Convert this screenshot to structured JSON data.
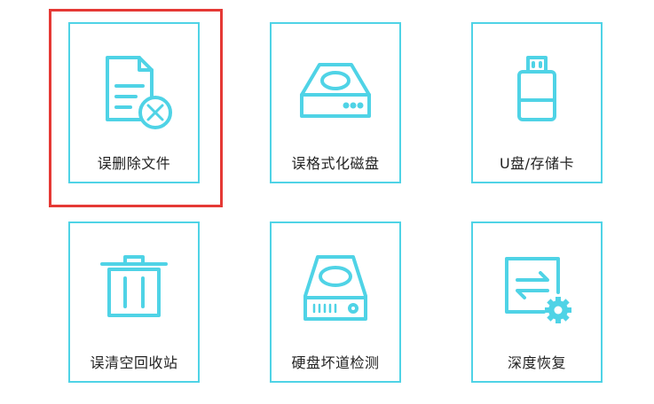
{
  "colors": {
    "accent": "#4fd3e6",
    "selection": "#e53935",
    "text": "#222222"
  },
  "selected_tile": "deleted-files",
  "tiles": [
    {
      "id": "deleted-files",
      "label": "误删除文件",
      "icon": "file-deleted-icon"
    },
    {
      "id": "formatted-disk",
      "label": "误格式化磁盘",
      "icon": "hard-disk-icon"
    },
    {
      "id": "usb-card",
      "label": "U盘/存储卡",
      "icon": "usb-drive-icon"
    },
    {
      "id": "recycle-bin",
      "label": "误清空回收站",
      "icon": "trash-bin-icon"
    },
    {
      "id": "bad-sector",
      "label": "硬盘坏道检测",
      "icon": "hard-disk-check-icon"
    },
    {
      "id": "deep-recovery",
      "label": "深度恢复",
      "icon": "deep-recovery-icon"
    }
  ]
}
